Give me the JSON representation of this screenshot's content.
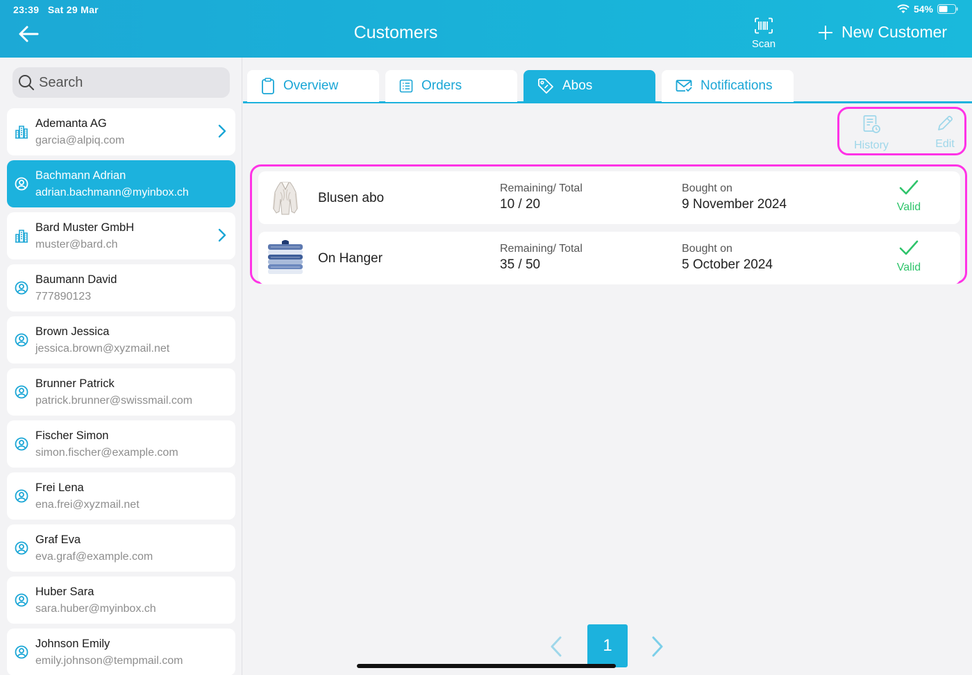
{
  "status": {
    "time": "23:39",
    "date": "Sat 29 Mar",
    "battery": "54%"
  },
  "header": {
    "title": "Customers",
    "scan_label": "Scan",
    "new_customer_label": "New Customer"
  },
  "search": {
    "placeholder": "Search"
  },
  "customers": [
    {
      "name": "Ademanta AG",
      "sub": "garcia@alpiq.com",
      "type": "company",
      "active": false
    },
    {
      "name": "Bachmann Adrian",
      "sub": "adrian.bachmann@myinbox.ch",
      "type": "person",
      "active": true
    },
    {
      "name": "Bard Muster GmbH",
      "sub": "muster@bard.ch",
      "type": "company",
      "active": false
    },
    {
      "name": "Baumann David",
      "sub": "777890123",
      "type": "person",
      "active": false
    },
    {
      "name": "Brown Jessica",
      "sub": "jessica.brown@xyzmail.net",
      "type": "person",
      "active": false
    },
    {
      "name": "Brunner Patrick",
      "sub": "patrick.brunner@swissmail.com",
      "type": "person",
      "active": false
    },
    {
      "name": "Fischer Simon",
      "sub": "simon.fischer@example.com",
      "type": "person",
      "active": false
    },
    {
      "name": "Frei Lena",
      "sub": "ena.frei@xyzmail.net",
      "type": "person",
      "active": false
    },
    {
      "name": "Graf Eva",
      "sub": "eva.graf@example.com",
      "type": "person",
      "active": false
    },
    {
      "name": "Huber Sara",
      "sub": "sara.huber@myinbox.ch",
      "type": "person",
      "active": false
    },
    {
      "name": "Johnson Emily",
      "sub": "emily.johnson@tempmail.com",
      "type": "person",
      "active": false
    }
  ],
  "tabs": [
    {
      "label": "Overview",
      "icon": "clipboard-icon",
      "active": false
    },
    {
      "label": "Orders",
      "icon": "list-icon",
      "active": false
    },
    {
      "label": "Abos",
      "icon": "tag-icon",
      "active": true
    },
    {
      "label": "Notifications",
      "icon": "mail-icon",
      "active": false
    }
  ],
  "actions": {
    "history_label": "History",
    "edit_label": "Edit"
  },
  "abos": [
    {
      "name": "Blusen abo",
      "remaining_label": "Remaining/ Total",
      "remaining_value": "10 / 20",
      "bought_label": "Bought on",
      "bought_value": "9 November 2024",
      "status": "Valid",
      "thumb": "blouse-image"
    },
    {
      "name": "On Hanger",
      "remaining_label": "Remaining/ Total",
      "remaining_value": "35 / 50",
      "bought_label": "Bought on",
      "bought_value": "5 October 2024",
      "status": "Valid",
      "thumb": "shirts-image"
    }
  ],
  "pagination": {
    "current_page": "1"
  },
  "colors": {
    "accent": "#1cb2dd",
    "highlight": "#ff33e6",
    "valid": "#2fc46b"
  }
}
